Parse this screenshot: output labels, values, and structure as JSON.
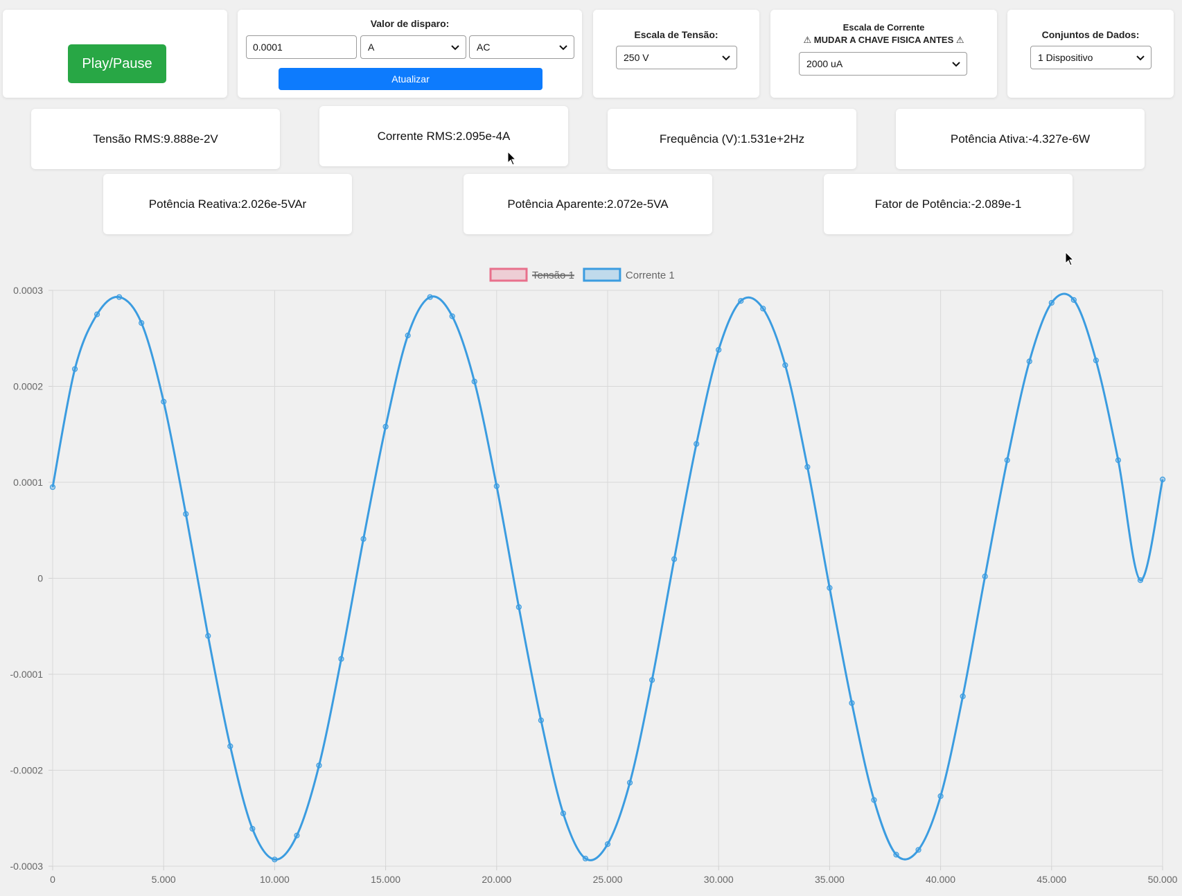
{
  "controls": {
    "play_pause": "Play/Pause",
    "trigger": {
      "label": "Valor de disparo:",
      "value": "0.0001",
      "unit": "A",
      "coupling": "AC",
      "update_button": "Atualizar"
    },
    "voltage_scale": {
      "label": "Escala de Tensão:",
      "value": "250 V"
    },
    "current_scale": {
      "label_line1": "Escala de Corrente",
      "label_line2": "⚠ MUDAR A CHAVE FISICA ANTES ⚠",
      "value": "2000 uA"
    },
    "datasets": {
      "label": "Conjuntos de Dados:",
      "value": "1 Dispositivo"
    }
  },
  "measurements": {
    "voltage_rms": "Tensão RMS:9.888e-2V",
    "current_rms": "Corrente RMS:2.095e-4A",
    "frequency": "Frequência (V):1.531e+2Hz",
    "active_power": "Potência Ativa:-4.327e-6W",
    "reactive_power": "Potência Reativa:2.026e-5VAr",
    "apparent_power": "Potência Aparente:2.072e-5VA",
    "power_factor": "Fator de Potência:-2.089e-1"
  },
  "colors": {
    "green_button": "#28a745",
    "blue_button": "#0d7bfd",
    "current_series": "#3b9ce0",
    "voltage_series": "#e8708c"
  },
  "chart_data": {
    "type": "line",
    "legend": [
      {
        "name": "Tensão 1",
        "color": "#e8708c",
        "hidden": true
      },
      {
        "name": "Corrente 1",
        "color": "#3b9ce0",
        "hidden": false
      }
    ],
    "legend_position": "top-center",
    "grid": true,
    "xlim": [
      0,
      50000
    ],
    "ylim": [
      -0.0003,
      0.0003
    ],
    "x_tick_labels": [
      "0",
      "5.000",
      "10.000",
      "15.000",
      "20.000",
      "25.000",
      "30.000",
      "35.000",
      "40.000",
      "45.000",
      "50.000"
    ],
    "y_tick_labels": [
      "0.0003",
      "0.0002",
      "0.0001",
      "0",
      "-0.0001",
      "-0.0002",
      "-0.0003"
    ],
    "series": [
      {
        "name": "Corrente 1",
        "x": [
          0,
          1000,
          2000,
          3000,
          4000,
          5000,
          6000,
          7000,
          8000,
          9000,
          10000,
          11000,
          12000,
          13000,
          14000,
          15000,
          16000,
          17000,
          18000,
          19000,
          20000,
          21000,
          22000,
          23000,
          24000,
          25000,
          26000,
          27000,
          28000,
          29000,
          30000,
          31000,
          32000,
          33000,
          34000,
          35000,
          36000,
          37000,
          38000,
          39000,
          40000,
          41000,
          42000,
          43000,
          44000,
          45000,
          46000,
          47000,
          48000,
          49000,
          50000
        ],
        "y": [
          9.5e-05,
          0.000218,
          0.000275,
          0.000293,
          0.000266,
          0.000184,
          6.7e-05,
          -6e-05,
          -0.000175,
          -0.000261,
          -0.000293,
          -0.000268,
          -0.000195,
          -8.4e-05,
          4.1e-05,
          0.000158,
          0.000253,
          0.000293,
          0.000273,
          0.000205,
          9.6e-05,
          -3e-05,
          -0.000148,
          -0.000245,
          -0.000292,
          -0.000277,
          -0.000213,
          -0.000106,
          2e-05,
          0.00014,
          0.000238,
          0.000289,
          0.000281,
          0.000222,
          0.000116,
          -1e-05,
          -0.00013,
          -0.000231,
          -0.000288,
          -0.000283,
          -0.000227,
          -0.000123,
          2e-06,
          0.000123,
          0.000226,
          0.000287,
          0.00029,
          0.000227,
          0.000123,
          -2e-06,
          0.000103
        ]
      }
    ]
  }
}
